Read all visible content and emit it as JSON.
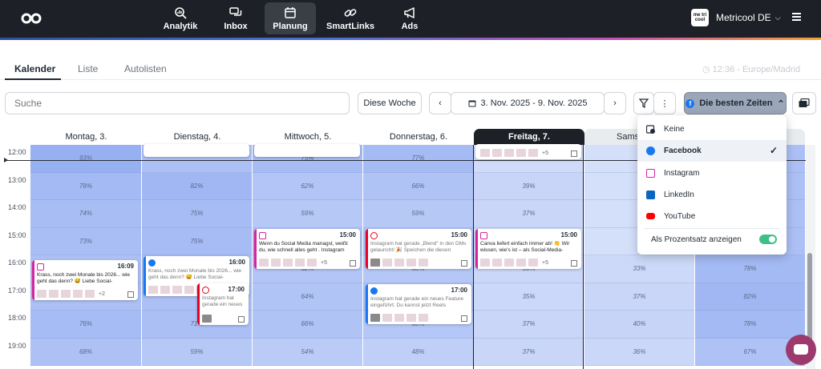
{
  "topnav": {
    "items": [
      {
        "label": "Analytik",
        "icon": "analytics-icon"
      },
      {
        "label": "Inbox",
        "icon": "inbox-icon"
      },
      {
        "label": "Planung",
        "icon": "calendar-icon",
        "active": true
      },
      {
        "label": "SmartLinks",
        "icon": "link-icon"
      },
      {
        "label": "Ads",
        "icon": "megaphone-icon"
      }
    ],
    "account": {
      "logo_text": "me tri cool",
      "name": "Metricool DE"
    }
  },
  "tabs": [
    {
      "label": "Kalender",
      "active": true
    },
    {
      "label": "Liste"
    },
    {
      "label": "Autolisten"
    }
  ],
  "timezone": "12:36 - Europe/Madrid",
  "toolbar": {
    "search_placeholder": "Suche",
    "this_week": "Diese Woche",
    "date_range": "3. Nov. 2025 - 9. Nov. 2025",
    "best_times": "Die besten Zeiten"
  },
  "calendar": {
    "days": [
      "Montag, 3.",
      "Dienstag, 4.",
      "Mittwoch, 5.",
      "Donnerstag, 6.",
      "Freitag, 7.",
      "Sams"
    ],
    "today_index": 4,
    "hours": [
      "12:00",
      "13:00",
      "14:00",
      "15:00",
      "16:00",
      "17:00",
      "18:00",
      "19:00"
    ],
    "percentages": [
      [
        "93%",
        "",
        "75%",
        "77%",
        "",
        "",
        ""
      ],
      [
        "78%",
        "82%",
        "62%",
        "66%",
        "39%",
        "",
        ""
      ],
      [
        "74%",
        "75%",
        "59%",
        "59%",
        "37%",
        "",
        ""
      ],
      [
        "73%",
        "75%",
        "",
        "",
        "",
        "",
        ""
      ],
      [
        "",
        "",
        "62%",
        "60%",
        "36%",
        "33%",
        "78%"
      ],
      [
        "",
        "",
        "64%",
        "",
        "35%",
        "37%",
        "82%"
      ],
      [
        "76%",
        "71%",
        "66%",
        "60%",
        "37%",
        "40%",
        "78%"
      ],
      [
        "68%",
        "59%",
        "54%",
        "48%",
        "37%",
        "36%",
        "67%"
      ]
    ],
    "cards": [
      {
        "id": "mon-1609",
        "network": "instagram",
        "time": "16:09",
        "text": "Krass, noch zwei Monate bis 2026... wie geht das denn? 😅 Liebe Social-",
        "more": "+2"
      },
      {
        "id": "tue-1600",
        "network": "facebook",
        "time": "16:00",
        "text": "Krass, noch zwei Monate bis 2026... wie geht das denn? 😅 Liebe Social-",
        "more": ""
      },
      {
        "id": "tue-1700",
        "network": "pinterest",
        "time": "17:00",
        "text": "Instagram hat gerade ein neues",
        "more": ""
      },
      {
        "id": "wed-1500",
        "network": "instagram",
        "time": "15:00",
        "text": "Wenn du Social Media managst, weißt du, wie schnell alles geht . Instagram",
        "more": "+5"
      },
      {
        "id": "thu-1500",
        "network": "pinterest",
        "time": "15:00",
        "text": "Instagram hat gerade „Blend\" in den DMs gelauncht! 🎉 Speichen die diesen",
        "more": ""
      },
      {
        "id": "thu-1700",
        "network": "facebook",
        "time": "17:00",
        "text": "Instagram hat gerade ein neues Feature eingeführt: Du kannst jetzt Reels",
        "more": ""
      },
      {
        "id": "fri-1500",
        "network": "instagram",
        "time": "15:00",
        "text": "Canva liefert einfach immer ab! 👏 Wir wissen, wie's ist – als Social-Media-",
        "more": "+5"
      },
      {
        "id": "fri-top",
        "network": "",
        "time": "",
        "text": "",
        "more": "+5"
      }
    ]
  },
  "dropdown": {
    "items": [
      {
        "label": "Keine",
        "icon": "calendar-none-icon"
      },
      {
        "label": "Facebook",
        "icon": "facebook-icon",
        "selected": true
      },
      {
        "label": "Instagram",
        "icon": "instagram-icon"
      },
      {
        "label": "LinkedIn",
        "icon": "linkedin-icon"
      },
      {
        "label": "YouTube",
        "icon": "youtube-icon"
      }
    ],
    "percentage_label": "Als Prozentsatz anzeigen",
    "percentage_on": true
  },
  "colors": {
    "facebook": "#1877f2",
    "instagram": "#d6249f",
    "pinterest": "#e60023",
    "linkedin": "#0a66c2",
    "youtube": "#ff0000",
    "toggle_on": "#3fbf88"
  }
}
